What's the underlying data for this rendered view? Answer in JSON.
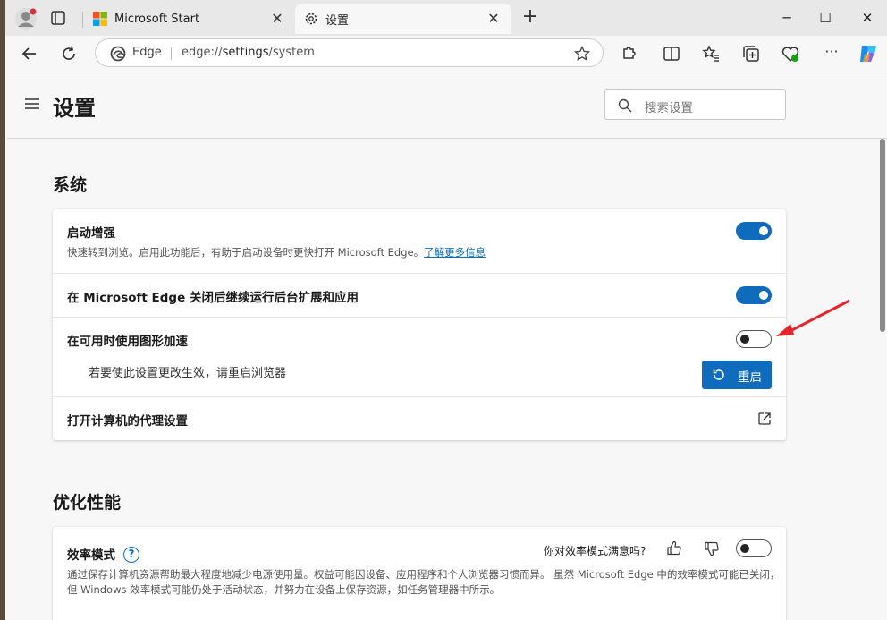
{
  "browser": {
    "tabs": [
      {
        "title": "Microsoft Start"
      },
      {
        "title": "设置"
      }
    ],
    "address": {
      "site_label": "Edge",
      "url_prefix": "edge://",
      "url_path": "settings",
      "url_suffix": "/system"
    }
  },
  "header": {
    "title": "设置",
    "search_placeholder": "搜索设置"
  },
  "system": {
    "section_title": "系统",
    "startup_boost": {
      "label": "启动增强",
      "desc": "快速转到浏览。启用此功能后，有助于启动设备时更快打开 Microsoft Edge。",
      "link": "了解更多信息",
      "enabled": true
    },
    "background_run": {
      "label": "在 Microsoft Edge 关闭后继续运行后台扩展和应用",
      "enabled": true
    },
    "hardware_accel": {
      "label": "在可用时使用图形加速",
      "enabled": false,
      "restart_note": "若要使此设置更改生效，请重启浏览器",
      "restart_button": "重启"
    },
    "proxy": {
      "label": "打开计算机的代理设置"
    }
  },
  "performance": {
    "section_title": "优化性能",
    "efficiency": {
      "label": "效率模式",
      "help": "?",
      "feedback_question": "你对效率模式满意吗?",
      "enabled": false,
      "desc": "通过保存计算机资源帮助最大程度地减少电源使用量。权益可能因设备、应用程序和个人浏览器习惯而异。 虽然 Microsoft Edge 中的效率模式可能已关闭，但 Windows 效率模式可能仍处于活动状态，并努力在设备上保存资源，如任务管理器中所示。"
    }
  },
  "colors": {
    "accent": "#0f6cbd",
    "annotation_arrow": "#e8242a"
  }
}
